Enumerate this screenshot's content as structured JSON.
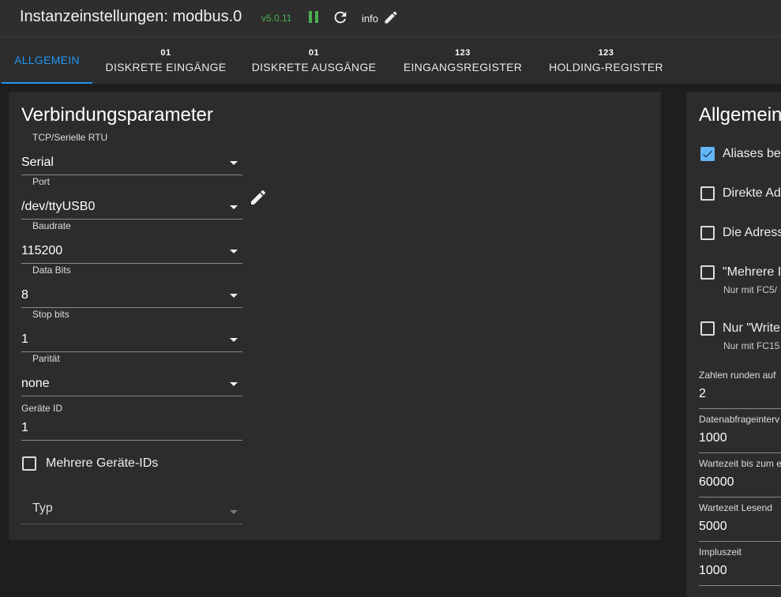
{
  "header": {
    "title": "Instanzeinstellungen: modbus.0",
    "version": "v5.0.11",
    "info_label": "info"
  },
  "tabs": [
    {
      "tag": "",
      "label": "ALLGEMEIN",
      "active": true
    },
    {
      "tag": "01",
      "label": "DISKRETE EINGÄNGE"
    },
    {
      "tag": "01",
      "label": "DISKRETE AUSGÄNGE"
    },
    {
      "tag": "123",
      "label": "EINGANGSREGISTER"
    },
    {
      "tag": "123",
      "label": "HOLDING-REGISTER"
    }
  ],
  "connection": {
    "title": "Verbindungsparameter",
    "fields": [
      {
        "label": "TCP/Serielle RTU",
        "value": "Serial"
      },
      {
        "label": "Port",
        "value": "/dev/ttyUSB0"
      },
      {
        "label": "Baudrate",
        "value": "115200"
      },
      {
        "label": "Data Bits",
        "value": "8"
      },
      {
        "label": "Stop bits",
        "value": "1"
      },
      {
        "label": "Parität",
        "value": "none"
      }
    ],
    "device_id": {
      "label": "Geräte ID",
      "value": "1"
    },
    "multi_device_label": "Mehrere Geräte-IDs",
    "type_placeholder": "Typ"
  },
  "general": {
    "title": "Allgemein",
    "checkboxes": [
      {
        "label": "Aliases be",
        "checked": true,
        "sub": ""
      },
      {
        "label": "Direkte Ad",
        "checked": false,
        "sub": ""
      },
      {
        "label": "Die Adress",
        "checked": false,
        "sub": ""
      },
      {
        "label": "\"Mehrere I",
        "checked": false,
        "sub": "Nur mit FC5/"
      },
      {
        "label": "Nur \"Write",
        "checked": false,
        "sub": "Nur mit FC15"
      }
    ],
    "fields": [
      {
        "label": "Zahlen runden auf",
        "value": "2"
      },
      {
        "label": "Datenabfrageinterv",
        "value": "1000"
      },
      {
        "label": "Wartezeit bis zum e",
        "value": "60000"
      },
      {
        "label": "Wartezeit Lesend",
        "value": "5000"
      },
      {
        "label": "Impluszeit",
        "value": "1000"
      }
    ]
  },
  "colors": {
    "accent": "#2196f3",
    "status_green": "#4caf50",
    "checkbox_checked": "#64b5f6"
  }
}
